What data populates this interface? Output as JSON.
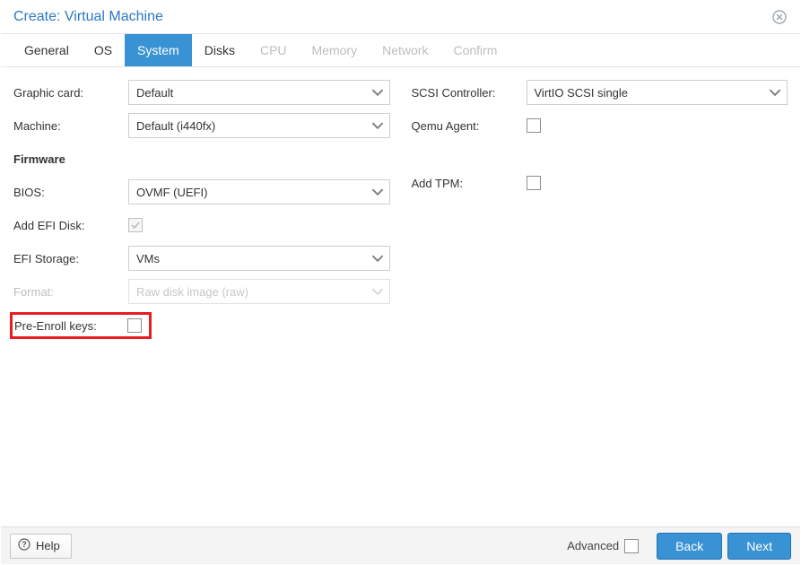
{
  "title": "Create: Virtual Machine",
  "tabs": [
    {
      "label": "General",
      "state": "enabled"
    },
    {
      "label": "OS",
      "state": "enabled"
    },
    {
      "label": "System",
      "state": "active"
    },
    {
      "label": "Disks",
      "state": "enabled"
    },
    {
      "label": "CPU",
      "state": "disabled"
    },
    {
      "label": "Memory",
      "state": "disabled"
    },
    {
      "label": "Network",
      "state": "disabled"
    },
    {
      "label": "Confirm",
      "state": "disabled"
    }
  ],
  "left": {
    "graphic_card": {
      "label": "Graphic card:",
      "value": "Default"
    },
    "machine": {
      "label": "Machine:",
      "value": "Default (i440fx)"
    },
    "firmware_heading": "Firmware",
    "bios": {
      "label": "BIOS:",
      "value": "OVMF (UEFI)"
    },
    "add_efi_disk": {
      "label": "Add EFI Disk:",
      "checked": true
    },
    "efi_storage": {
      "label": "EFI Storage:",
      "value": "VMs"
    },
    "format": {
      "label": "Format:",
      "value": "Raw disk image (raw)",
      "disabled": true
    },
    "pre_enroll_keys": {
      "label": "Pre-Enroll keys:",
      "checked": false
    }
  },
  "right": {
    "scsi_controller": {
      "label": "SCSI Controller:",
      "value": "VirtIO SCSI single"
    },
    "qemu_agent": {
      "label": "Qemu Agent:",
      "checked": false
    },
    "add_tpm": {
      "label": "Add TPM:",
      "checked": false
    }
  },
  "footer": {
    "help": "Help",
    "advanced": {
      "label": "Advanced",
      "checked": false
    },
    "back": "Back",
    "next": "Next"
  }
}
